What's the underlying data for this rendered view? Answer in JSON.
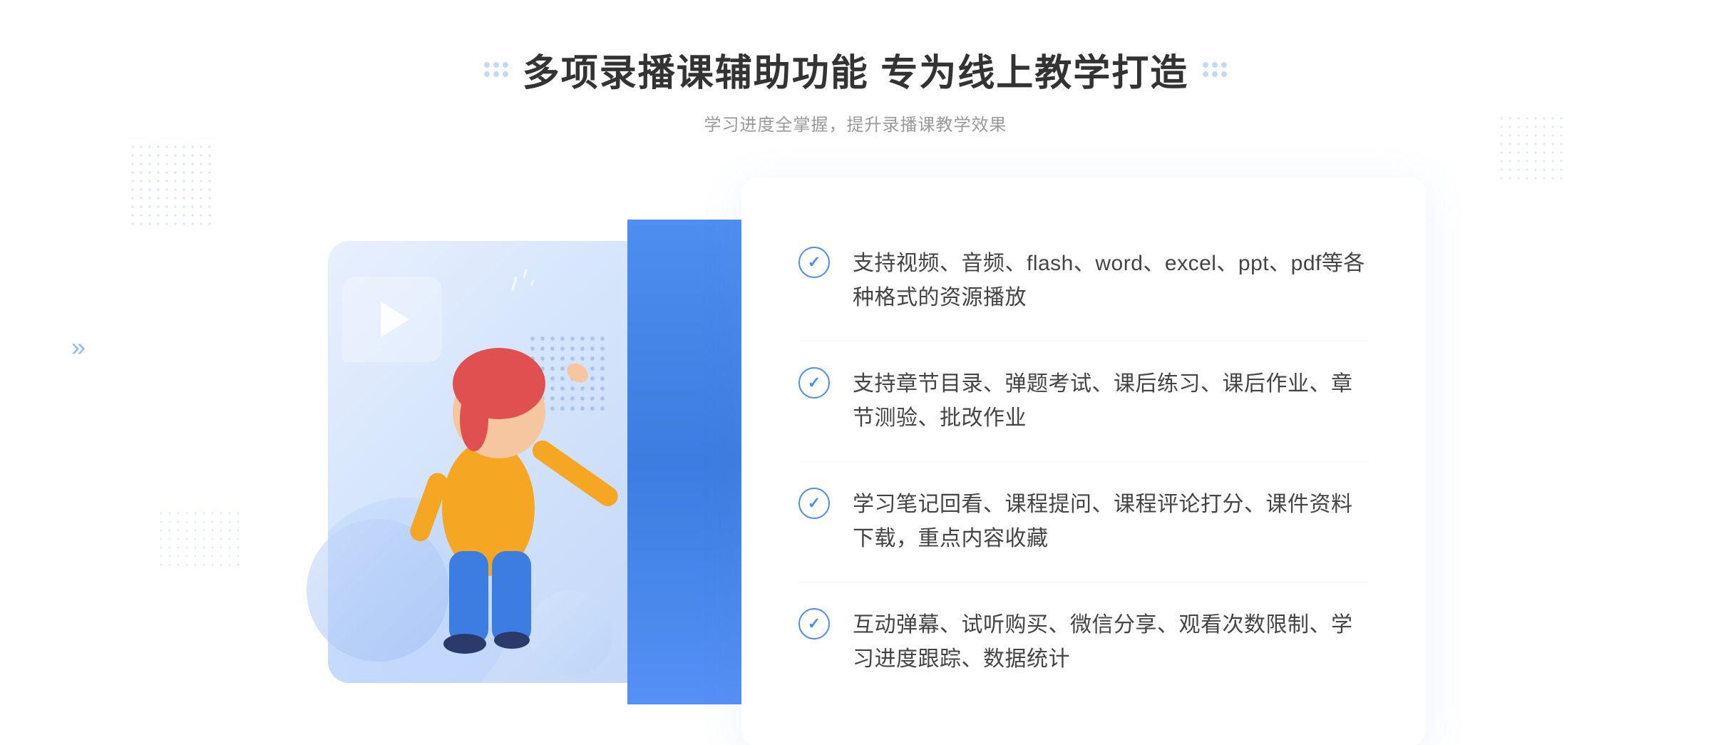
{
  "header": {
    "main_title": "多项录播课辅助功能 专为线上教学打造",
    "subtitle": "学习进度全掌握，提升录播课教学效果"
  },
  "features": [
    {
      "id": 1,
      "text": "支持视频、音频、flash、word、excel、ppt、pdf等各种格式的资源播放"
    },
    {
      "id": 2,
      "text": "支持章节目录、弹题考试、课后练习、课后作业、章节测验、批改作业"
    },
    {
      "id": 3,
      "text": "学习笔记回看、课程提问、课程评论打分、课件资料下载，重点内容收藏"
    },
    {
      "id": 4,
      "text": "互动弹幕、试听购买、微信分享、观看次数限制、学习进度跟踪、数据统计"
    }
  ],
  "decorations": {
    "chevron_left": "»",
    "left_dots_label": "decorative-dots-left",
    "right_dots_label": "decorative-dots-right"
  }
}
